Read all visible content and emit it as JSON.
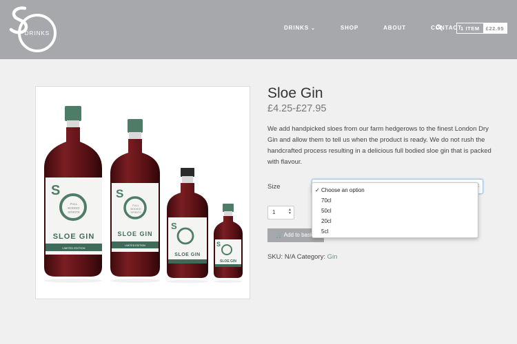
{
  "brand": {
    "logo_letters": "SO",
    "logo_word": "DRINKS"
  },
  "nav": {
    "items": [
      {
        "label": "DRINKS",
        "has_dropdown": true
      },
      {
        "label": "SHOP"
      },
      {
        "label": "ABOUT"
      },
      {
        "label": "CONTACT"
      }
    ],
    "search_icon": "search-icon"
  },
  "cart": {
    "count": "1 ITEM",
    "total": "£22.95"
  },
  "product": {
    "title": "Sloe Gin",
    "price": "£4.25-£27.95",
    "description": "We add handpicked sloes from our farm hedgerows to the finest London Dry Gin and allow them to tell us when the product is ready. We do not rush the handcrafted process resulting in a delicious full bodied sloe gin that is packed with flavour.",
    "size_label": "Size",
    "size_options": [
      "Choose an option",
      "70cl",
      "50cl",
      "20cl",
      "5cl"
    ],
    "selected_option": "Choose an option",
    "quantity": "1",
    "add_button": "Add to basket",
    "sku_label": "SKU:",
    "sku_value": "N/A",
    "category_label": "Category:",
    "category_value": "Gin",
    "bottle_label": {
      "brand": "SO",
      "tag": "FULL BODIED SPIRITS",
      "name": "SLOE GIN",
      "edition": "LIMITED EDITION"
    }
  },
  "colors": {
    "header_bg": "#a7a8ab",
    "accent_green": "#3f6b5a",
    "gin_red": "#6e1a1d"
  }
}
